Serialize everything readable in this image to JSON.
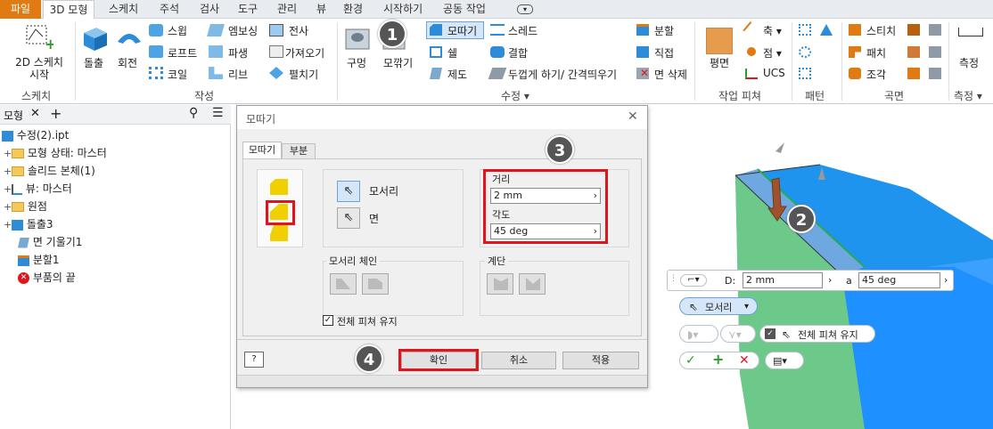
{
  "menubar": {
    "tabs": [
      "파일",
      "3D 모형",
      "스케치",
      "주석",
      "검사",
      "도구",
      "관리",
      "뷰",
      "환경",
      "시작하기",
      "공동 작업"
    ]
  },
  "ribbon": {
    "sketch": {
      "label": "2D 스케치\n시작",
      "group": "스케치"
    },
    "create": {
      "extrude": "돌출",
      "revolve": "회전",
      "sweep": "스윕",
      "loft": "로프트",
      "coil": "코일",
      "emboss": "엠보싱",
      "derive": "파생",
      "rib": "리브",
      "decal": "전사",
      "import": "가져오기",
      "unwrap": "펼치기",
      "group": "작성"
    },
    "modify": {
      "hole": "구멍",
      "fillet": "모깎기",
      "chamfer": "모따기",
      "shell": "쉘",
      "draft": "제도",
      "thread": "스레드",
      "combine": "결합",
      "thicken": "두껍게 하기/ 간격띄우기",
      "split": "분할",
      "direct": "직접",
      "delete_face": "면 삭제",
      "group": "수정 ▾"
    },
    "workfeatures": {
      "plane": "평면",
      "axis": "축 ▾",
      "point": "점 ▾",
      "ucs": "UCS",
      "group": "작업 피쳐"
    },
    "pattern": {
      "group": "패턴"
    },
    "surface": {
      "stitch": "스티치",
      "patch": "패치",
      "sculpt": "조각",
      "group": "곡면"
    },
    "measure": {
      "label": "측정",
      "group": "측정 ▾"
    }
  },
  "browser": {
    "tab": "모형",
    "items": [
      "수정(2).ipt",
      "모형 상태: 마스터",
      "솔리드 본체(1)",
      "뷰: 마스터",
      "원점",
      "돌출3",
      "면 기울기1",
      "분할1",
      "부품의 끝"
    ]
  },
  "dialog": {
    "title": "모따기",
    "tabs": [
      "모따기",
      "부분"
    ],
    "edges_label": "모서리",
    "faces_label": "면",
    "distance_label": "거리",
    "distance_value": "2 mm",
    "angle_label": "각도",
    "angle_value": "45 deg",
    "edge_chain_label": "모서리 체인",
    "setback_label": "계단",
    "preserve_label": "전체 피쳐 유지",
    "ok": "확인",
    "cancel": "취소",
    "apply": "적용"
  },
  "minitoolbar": {
    "d_label": "D:",
    "d_value": "2 mm",
    "a_label": "a",
    "a_value": "45 deg",
    "edges": "모서리",
    "preserve": "전체 피쳐 유지"
  },
  "callouts": [
    "1",
    "2",
    "3",
    "4"
  ],
  "colors": {
    "accent": "#e07a12",
    "highlight": "#e0141a",
    "model_blue": "#1e90ff",
    "model_green": "#6cc98a"
  }
}
